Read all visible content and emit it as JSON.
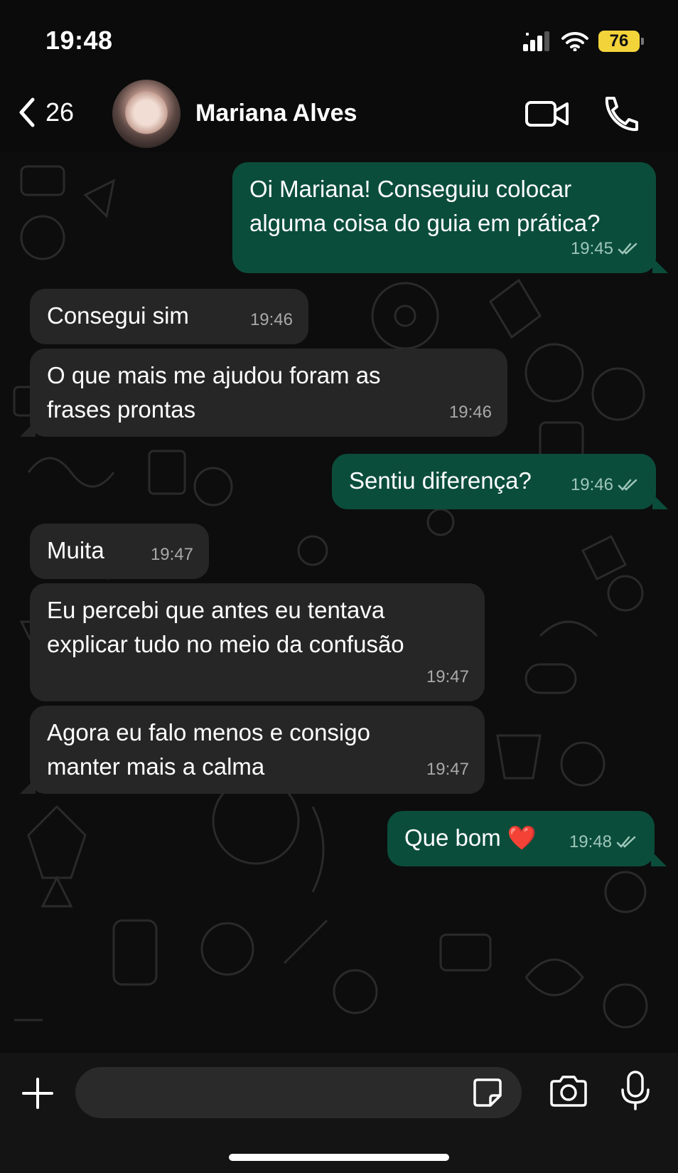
{
  "status": {
    "time": "19:48",
    "battery": "76"
  },
  "header": {
    "back_count": "26",
    "contact_name": "Mariana Alves"
  },
  "messages": [
    {
      "direction": "out",
      "text": "Oi Mariana! Conseguiu colocar alguma coisa do guia em prática?",
      "time": "19:45"
    },
    {
      "direction": "in",
      "text": "Consegui sim",
      "time": "19:46"
    },
    {
      "direction": "in",
      "text": "O que mais me ajudou foram as frases prontas",
      "time": "19:46"
    },
    {
      "direction": "out",
      "text": "Sentiu diferença?",
      "time": "19:46"
    },
    {
      "direction": "in",
      "text": "Muita",
      "time": "19:47"
    },
    {
      "direction": "in",
      "text": "Eu percebi que antes eu tentava explicar tudo no meio da confusão",
      "time": "19:47"
    },
    {
      "direction": "in",
      "text": "Agora eu falo menos e consigo manter mais a calma",
      "time": "19:47"
    },
    {
      "direction": "out",
      "text": "Que bom ❤️",
      "time": "19:48"
    }
  ],
  "colors": {
    "outgoing": "#0b4d3b",
    "incoming": "#262626",
    "background": "#0b0b0b"
  }
}
